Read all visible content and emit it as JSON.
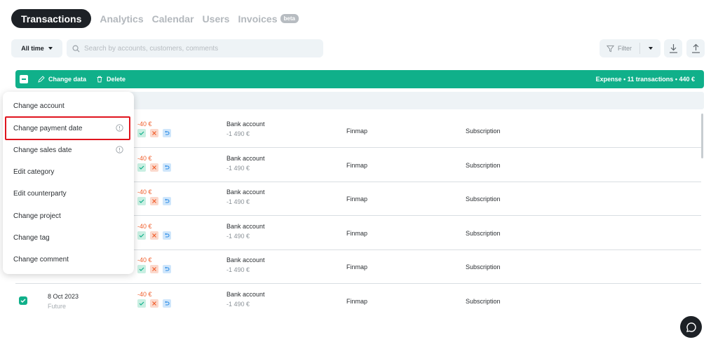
{
  "nav": {
    "tabs": [
      "Transactions",
      "Analytics",
      "Calendar",
      "Users",
      "Invoices"
    ],
    "beta": "beta"
  },
  "toolbar": {
    "period": "All time",
    "search_placeholder": "Search by accounts, customers, comments",
    "filter_label": "Filter"
  },
  "selection": {
    "change_data": "Change data",
    "delete": "Delete",
    "summary": "Expense • 11 transactions • 440 €"
  },
  "menu": {
    "items": [
      "Change account",
      "Change payment date",
      "Change sales date",
      "Edit category",
      "Edit counterparty",
      "Change project",
      "Change tag",
      "Change comment"
    ]
  },
  "rows": [
    {
      "amount": "-40 €",
      "account": "Bank account",
      "balance": "-1 490 €",
      "counterparty": "Finmap",
      "category": "Subscription"
    },
    {
      "amount": "-40 €",
      "account": "Bank account",
      "balance": "-1 490 €",
      "counterparty": "Finmap",
      "category": "Subscription"
    },
    {
      "amount": "-40 €",
      "account": "Bank account",
      "balance": "-1 490 €",
      "counterparty": "Finmap",
      "category": "Subscription"
    },
    {
      "amount": "-40 €",
      "account": "Bank account",
      "balance": "-1 490 €",
      "counterparty": "Finmap",
      "category": "Subscription"
    },
    {
      "amount": "-40 €",
      "account": "Bank account",
      "balance": "-1 490 €",
      "counterparty": "Finmap",
      "category": "Subscription"
    },
    {
      "date": "8 Oct 2023",
      "status": "Future",
      "amount": "-40 €",
      "account": "Bank account",
      "balance": "-1 490 €",
      "counterparty": "Finmap",
      "category": "Subscription"
    }
  ],
  "colors": {
    "accent": "#10b08a",
    "negative": "#f0602e",
    "highlight": "#e0151e",
    "dark": "#1d2126"
  }
}
